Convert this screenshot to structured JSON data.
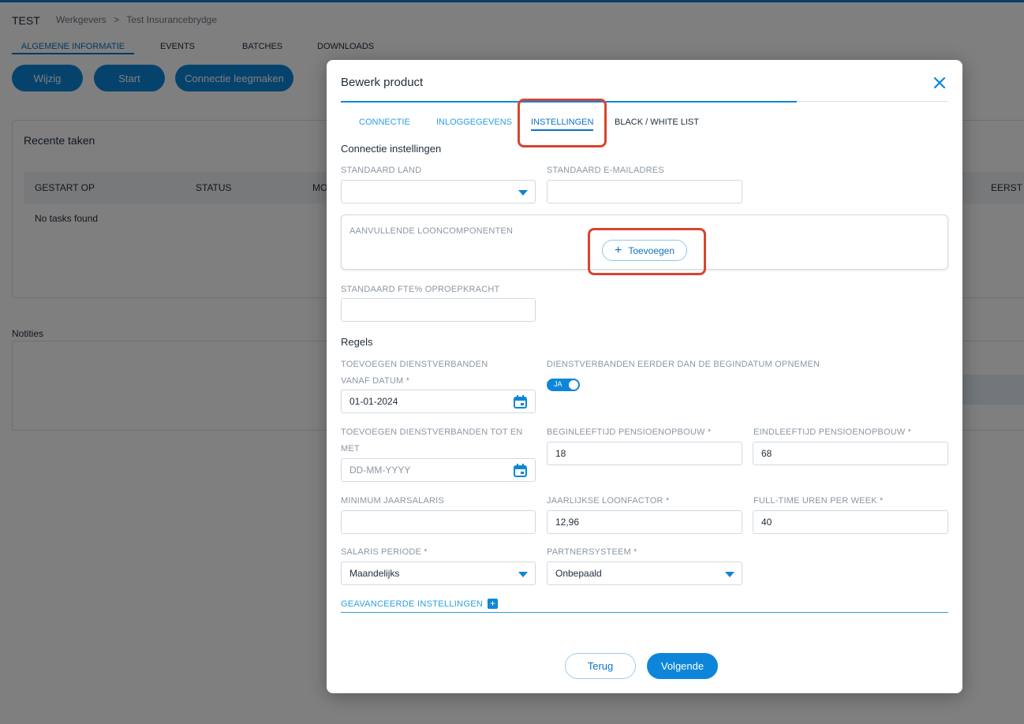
{
  "background": {
    "app_title": "TEST",
    "breadcrumb": [
      "Werkgevers",
      ">",
      "Test Insurancebrydge"
    ],
    "tabs": [
      "ALGEMENE INFORMATIE",
      "EVENTS",
      "BATCHES",
      "DOWNLOADS"
    ],
    "buttons": [
      "Wijzig",
      "Start",
      "Connectie leegmaken"
    ],
    "recent_title": "Recente taken",
    "columns": [
      "GESTART OP",
      "STATUS",
      "MO",
      "EERST C"
    ],
    "no_tasks": "No tasks found",
    "notes_label": "Notities"
  },
  "modal": {
    "title": "Bewerk product",
    "close_icon": "close-icon",
    "tabs": [
      "CONNECTIE",
      "INLOGGEGEVENS",
      "INSTELLINGEN",
      "BLACK / WHITE LIST"
    ],
    "active_tab": "INSTELLINGEN",
    "connectie_section": "Connectie instellingen",
    "standaard_land_label": "STANDAARD LAND",
    "standaard_land_value": "",
    "standaard_email_label": "STANDAARD E-MAILADRES",
    "standaard_email_value": "",
    "loon_label": "AANVULLENDE LOONCOMPONENTEN",
    "add_label": "Toevoegen",
    "fte_label": "STANDAARD FTE% OPROEPKRACHT",
    "fte_value": "",
    "regels_section": "Regels",
    "vanaf_label": "TOEVOEGEN DIENSTVERBANDEN VANAF DATUM *",
    "vanaf_value": "01-01-2024",
    "eerder_label": "DIENSTVERBANDEN EERDER DAN DE BEGINDATUM OPNEMEN",
    "toggle_label": "JA",
    "toggle_on": true,
    "tot_label": "TOEVOEGEN DIENSTVERBANDEN TOT EN MET",
    "tot_placeholder": "DD-MM-YYYY",
    "beginleeftijd_label": "BEGINLEEFTIJD PENSIOENOPBOUW *",
    "beginleeftijd_value": "18",
    "eindleeftijd_label": "EINDLEEFTIJD PENSIOENOPBOUW *",
    "eindleeftijd_value": "68",
    "min_salaris_label": "MINIMUM JAARSALARIS",
    "min_salaris_value": "",
    "loonfactor_label": "JAARLIJKSE LOONFACTOR *",
    "loonfactor_value": "12,96",
    "fulltime_label": "FULL-TIME UREN PER WEEK *",
    "fulltime_value": "40",
    "salaris_periode_label": "SALARIS PERIODE *",
    "salaris_periode_value": "Maandelijks",
    "partnersysteem_label": "PARTNERSYSTEEM *",
    "partnersysteem_value": "Onbepaald",
    "advanced_label": "GEAVANCEERDE INSTELLINGEN",
    "back_label": "Terug",
    "next_label": "Volgende"
  },
  "colors": {
    "accent": "#0d86d9",
    "highlight": "#d9442f"
  }
}
